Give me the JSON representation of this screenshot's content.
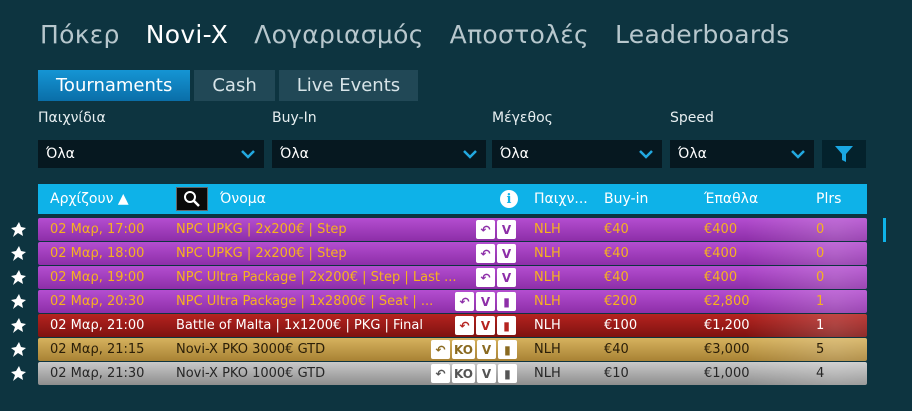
{
  "topnav": [
    "Πόκερ",
    "Novi-X",
    "Λογαριασμός",
    "Αποστολές",
    "Leaderboards"
  ],
  "subtabs": [
    "Tournaments",
    "Cash",
    "Live Events"
  ],
  "filters": {
    "games": {
      "label": "Παιχνίδια",
      "value": "Όλα"
    },
    "buyin": {
      "label": "Buy-In",
      "value": "Όλα"
    },
    "size": {
      "label": "Μέγεθος",
      "value": "Όλα"
    },
    "speed": {
      "label": "Speed",
      "value": "Όλα"
    }
  },
  "columns": {
    "starts": "Αρχίζουν ▲",
    "name": "Όνομα",
    "game": "Παιχν...",
    "buyin": "Buy-in",
    "prizes": "Έπαθλα",
    "players": "Plrs"
  },
  "rows": [
    {
      "time": "02 Μαρ, 17:00",
      "name": "NPC UPKG | 2x200€ | Step",
      "badges": [
        "↶",
        "V"
      ],
      "game": "NLH",
      "buyin": "€40",
      "prize": "€400",
      "plrs": "0",
      "style": "purple"
    },
    {
      "time": "02 Μαρ, 18:00",
      "name": "NPC UPKG | 2x200€ | Step",
      "badges": [
        "↶",
        "V"
      ],
      "game": "NLH",
      "buyin": "€40",
      "prize": "€400",
      "plrs": "0",
      "style": "purple"
    },
    {
      "time": "02 Μαρ, 19:00",
      "name": "NPC Ultra Package | 2x200€ | Step | Last ...",
      "badges": [
        "↶",
        "V"
      ],
      "game": "NLH",
      "buyin": "€40",
      "prize": "€400",
      "plrs": "0",
      "style": "purple"
    },
    {
      "time": "02 Μαρ, 20:30",
      "name": "NPC Ultra Package | 1x2800€ | Seat | ...",
      "badges": [
        "↶",
        "V",
        "▮"
      ],
      "game": "NLH",
      "buyin": "€200",
      "prize": "€2,800",
      "plrs": "1",
      "style": "purple"
    },
    {
      "time": "02 Μαρ, 21:00",
      "name": "Battle of Malta | 1x1200€ | PKG | Final",
      "badges": [
        "↶",
        "V",
        "▮"
      ],
      "game": "NLH",
      "buyin": "€100",
      "prize": "€1,200",
      "plrs": "1",
      "style": "red"
    },
    {
      "time": "02 Μαρ, 21:15",
      "name": "Novi-X PKO 3000€ GTD",
      "badges": [
        "↶",
        "KO",
        "V",
        "▮"
      ],
      "game": "NLH",
      "buyin": "€40",
      "prize": "€3,000",
      "plrs": "5",
      "style": "gold"
    },
    {
      "time": "02 Μαρ, 21:30",
      "name": "Novi-X PKO 1000€ GTD",
      "badges": [
        "↶",
        "KO",
        "V",
        "▮"
      ],
      "game": "NLH",
      "buyin": "€10",
      "prize": "€1,000",
      "plrs": "4",
      "style": "silver"
    }
  ],
  "colors": {
    "accent": "#0eb2e8",
    "background": "#0d3440"
  },
  "icons": {
    "favorite": "pin-icon",
    "search": "search-icon",
    "info": "info-icon",
    "filter": "filter-icon"
  }
}
